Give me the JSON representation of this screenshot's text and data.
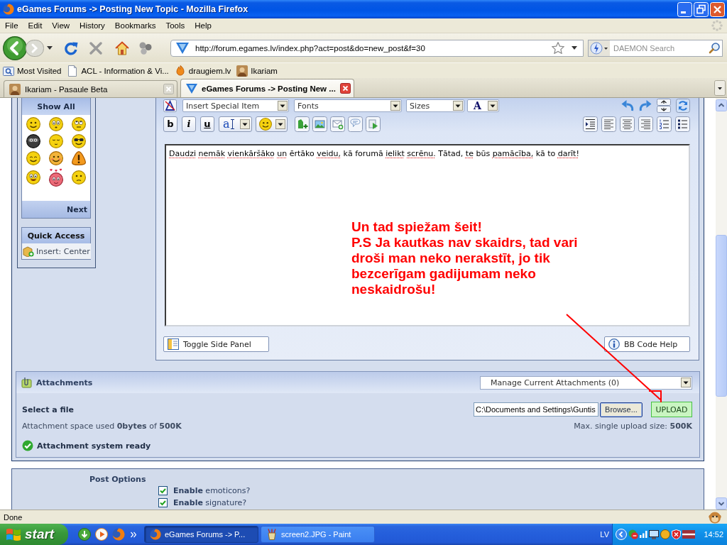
{
  "window": {
    "title": "eGames Forums -> Posting New Topic - Mozilla Firefox"
  },
  "menu": [
    "File",
    "Edit",
    "View",
    "History",
    "Bookmarks",
    "Tools",
    "Help"
  ],
  "toolbar": {
    "url": "http://forum.egames.lv/index.php?act=post&do=new_post&f=30",
    "search": {
      "placeholder": "DAEMON Search"
    }
  },
  "bookmarks": [
    "Most Visited",
    "ACL - Information & Vi...",
    "draugiem.lv",
    "Ikariam"
  ],
  "tabs": [
    {
      "label": "Ikariam - Pasaule Beta",
      "selected": false
    },
    {
      "label": "eGames Forums -> Posting New ...",
      "selected": true
    }
  ],
  "side_panel": {
    "emoticons": {
      "header": "Show All",
      "footer": "Next"
    },
    "quick_access": {
      "header": "Quick Access",
      "items": [
        "Insert: Center"
      ]
    }
  },
  "editor": {
    "dropdowns": [
      "Insert Special Item",
      "Fonts",
      "Sizes"
    ],
    "color_button": "A",
    "format_buttons": [
      "b",
      "i",
      "u"
    ],
    "font_button": "a",
    "words": [
      {
        "text": "Daudzi",
        "misspelled": true
      },
      {
        "text": "nemāk",
        "misspelled": true
      },
      {
        "text": "vienkāršāko",
        "misspelled": true
      },
      {
        "text": "un",
        "misspelled": true
      },
      {
        "text": "ērtāko",
        "misspelled": false
      },
      {
        "text": "veidu,",
        "misspelled": true
      },
      {
        "text": "kā",
        "misspelled": false
      },
      {
        "text": "forumā",
        "misspelled": false
      },
      {
        "text": "ielikt",
        "misspelled": true
      },
      {
        "text": "scrēnu.",
        "misspelled": true
      },
      {
        "text": "Tātad,",
        "misspelled": false
      },
      {
        "text": "te",
        "misspelled": true
      },
      {
        "text": "būs",
        "misspelled": false
      },
      {
        "text": "pamācība,",
        "misspelled": true
      },
      {
        "text": "kā",
        "misspelled": false
      },
      {
        "text": "to",
        "misspelled": false
      },
      {
        "text": "darīt!",
        "misspelled": true
      }
    ],
    "buttons": [
      "Toggle Side Panel",
      "BB Code Help"
    ]
  },
  "annotation": {
    "lines": [
      "Un tad spiežam šeit!",
      "P.S Ja kautkas nav skaidrs, tad vari",
      "droši man neko nerakstīt, jo tik",
      "bezcerīgam gadijumam neko",
      "neskaidrošu!"
    ]
  },
  "attachments": {
    "title": "Attachments",
    "manage_dropdown": "Manage Current Attachments (0)",
    "select_label": "Select a file",
    "file_path": "C:\\Documents and Settings\\Guntis",
    "browse_button": "Browse...",
    "upload_button": "UPLOAD",
    "space_used": "Attachment space used **0bytes** of **500K**",
    "max_size": "Max. single upload size: **500K**",
    "status": "Attachment system ready"
  },
  "post_options": {
    "title": "Post Options",
    "options": [
      {
        "label": "**Enable** emoticons?",
        "checked": true
      },
      {
        "label": "**Enable** signature?",
        "checked": true
      }
    ]
  },
  "status_bar": {
    "text": "Done"
  },
  "taskbar": {
    "start": "start",
    "tasks": [
      {
        "label": "eGames Forums -> P...",
        "selected": true
      },
      {
        "label": "screen2.JPG - Paint",
        "selected": false
      }
    ],
    "language": "LV",
    "clock": "14:52"
  }
}
